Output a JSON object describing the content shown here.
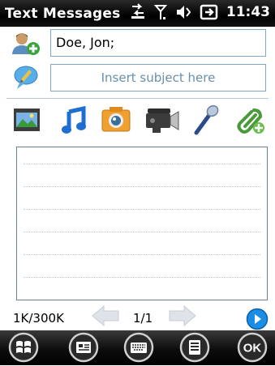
{
  "status_bar": {
    "title": "Text Messages",
    "time": "11:43",
    "icons": [
      "data-connection-icon",
      "signal-icon",
      "volume-icon",
      "battery-charging-icon"
    ]
  },
  "compose": {
    "to_value": "Doe, Jon;",
    "subject_placeholder": "Insert subject here",
    "body_value": ""
  },
  "attachments": [
    {
      "icon": "picture-icon"
    },
    {
      "icon": "music-note-icon"
    },
    {
      "icon": "camera-icon"
    },
    {
      "icon": "video-camera-icon"
    },
    {
      "icon": "microphone-icon"
    },
    {
      "icon": "attach-file-icon"
    }
  ],
  "footer": {
    "size": "1K/300K",
    "page": "1/1"
  },
  "softkeys": [
    {
      "icon": "windows-start-icon"
    },
    {
      "icon": "contact-card-icon"
    },
    {
      "icon": "keyboard-icon"
    },
    {
      "icon": "menu-icon"
    },
    {
      "icon": "ok-label",
      "label": "OK"
    }
  ],
  "colors": {
    "field_border": "#7fa9c8",
    "placeholder": "#6a8fae",
    "send_blue": "#1a8ee6",
    "status_bar": "#000000"
  }
}
